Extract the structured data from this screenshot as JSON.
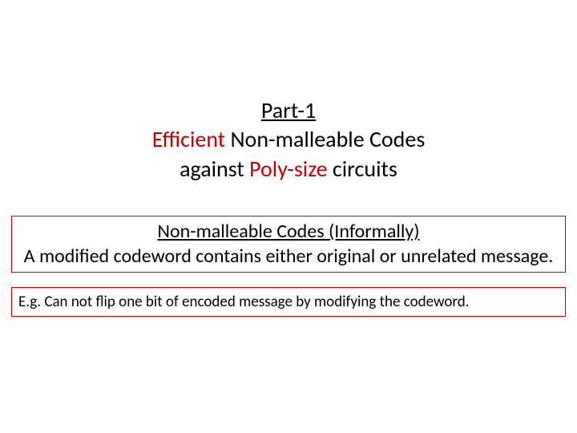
{
  "title": {
    "line1_text": "Part-1",
    "line2_prefix": "Efficient",
    "line2_rest": " Non-malleable Codes",
    "line3_prefix": "against ",
    "line3_mid": "Poly-size",
    "line3_suffix": " circuits"
  },
  "box1": {
    "heading": "Non-malleable Codes (Informally)",
    "body": "A modified codeword contains either original or unrelated message."
  },
  "box2": {
    "body": "E.g. Can not flip one bit of encoded message by modifying the codeword."
  }
}
